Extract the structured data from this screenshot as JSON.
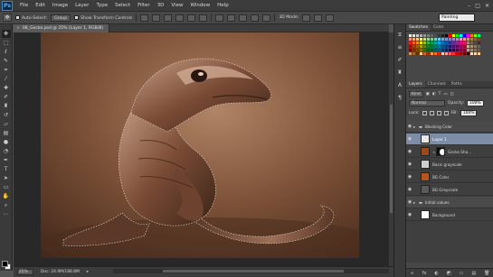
{
  "app": {
    "logo": "Ps",
    "menu": [
      "File",
      "Edit",
      "Image",
      "Layer",
      "Type",
      "Select",
      "Filter",
      "3D",
      "View",
      "Window",
      "Help"
    ],
    "window_controls": [
      "–",
      "□",
      "✕"
    ]
  },
  "options_bar": {
    "auto_select_label": "Auto-Select:",
    "auto_select_value": "Group",
    "show_transform_label": "Show Transform Controls",
    "three_d_mode_label": "3D Mode:",
    "workspace": "Painting"
  },
  "document": {
    "tab_title": "08_Gecko.psd @ 25% (Layer 1, RGB/8)",
    "tab_close": "×",
    "zoom": "25%",
    "doc_info": "Doc: 24.9M/188.8M"
  },
  "tools": [
    "move",
    "marquee",
    "lasso",
    "quick-select",
    "crop",
    "eyedropper",
    "healing",
    "brush",
    "clone-stamp",
    "history-brush",
    "eraser",
    "gradient",
    "blur",
    "dodge",
    "pen",
    "type",
    "path-select",
    "shape",
    "hand",
    "zoom",
    "more"
  ],
  "right_panel": {
    "top_tabs": [
      "Swatches",
      "Color"
    ],
    "layer_tabs": [
      "Layers",
      "Channels",
      "Paths"
    ],
    "kind_filter": "Kind",
    "blend_mode": "Normal",
    "opacity_label": "Opacity:",
    "opacity_value": "100%",
    "lock_label": "Lock:",
    "fill_label": "Fill:",
    "fill_value": "100%",
    "layers": [
      {
        "name": "Blocking Color",
        "type": "group",
        "thumb": "#4a4a4a"
      },
      {
        "name": "Layer 1",
        "type": "layer",
        "thumb": "#e8e8e8",
        "selected": true
      },
      {
        "name": "Gecko Sha...",
        "type": "masked",
        "thumb": "#9a4a1a"
      },
      {
        "name": "Basic grayscale",
        "type": "layer",
        "thumb": "#cfcfcf"
      },
      {
        "name": "BG Color",
        "type": "layer",
        "thumb": "#b8551d"
      },
      {
        "name": "BG Grayscale",
        "type": "layer",
        "thumb": "#5a5a5a"
      },
      {
        "name": "Initial values",
        "type": "group",
        "thumb": "#4a4a4a"
      },
      {
        "name": "Background",
        "type": "layer",
        "thumb": "#ffffff"
      }
    ],
    "footer_icons": [
      "∞",
      "fx",
      "◐",
      "◩",
      "▭",
      "▤",
      "🗑"
    ]
  },
  "swatch_colors": [
    "#ffffff",
    "#e5e5e5",
    "#cccccc",
    "#b3b3b3",
    "#999999",
    "#808080",
    "#666666",
    "#4d4d4d",
    "#333333",
    "#1a1a1a",
    "#000000",
    "#ff0000",
    "#ffff00",
    "#00ff00",
    "#00ffff",
    "#0000ff",
    "#ff00ff",
    "#ff7f00",
    "#7fff00",
    "#00ff7f",
    "#f7977a",
    "#f9ad81",
    "#fdc68a",
    "#fff79a",
    "#c4df9b",
    "#a2d39c",
    "#82ca9d",
    "#7bcdc8",
    "#6ecff6",
    "#7ea7d8",
    "#8493ca",
    "#8882be",
    "#a187be",
    "#bc8dbf",
    "#f49ac2",
    "#f6989d",
    "#c69c6d",
    "#a67c52",
    "#8c6239",
    "#754c24",
    "#ed1c24",
    "#f26522",
    "#f7941d",
    "#fff200",
    "#8dc63f",
    "#39b54a",
    "#00a651",
    "#00a99d",
    "#00aeef",
    "#0072bc",
    "#0054a6",
    "#2e3192",
    "#662d91",
    "#92278f",
    "#ec008c",
    "#ed145b",
    "#998675",
    "#736357",
    "#534741",
    "#362f2d",
    "#9e0b0f",
    "#a0410d",
    "#a36209",
    "#aba000",
    "#598527",
    "#1a7b30",
    "#007236",
    "#00746b",
    "#0076a3",
    "#004b80",
    "#003471",
    "#1b1464",
    "#440e62",
    "#630460",
    "#9e005d",
    "#9e0039",
    "#c7b299",
    "#a8967d",
    "#8c7b6b",
    "#726358",
    "#790000",
    "#7b2e00",
    "#7d4900",
    "#827b00",
    "#406618",
    "#005e20",
    "#005826",
    "#005952",
    "#005b7f",
    "#003663",
    "#002157",
    "#0d004c",
    "#32004b",
    "#4b0049",
    "#7b0046",
    "#7a0026",
    "#b8a48b",
    "#9b8a76",
    "#80715f",
    "#665a4e",
    "#cc9966",
    "#996633",
    "#663300",
    "#ffcc99",
    "#cc6633",
    "#993300",
    "#ff9966",
    "#ff6633",
    "#cc3300",
    "#ffcccc",
    "#ff9999",
    "#ff6666",
    "#ff3333",
    "#cc0000",
    "#990000",
    "#660000",
    "#330000",
    "#ffe6cc",
    "#ffd9b3",
    "#ffcc99"
  ]
}
